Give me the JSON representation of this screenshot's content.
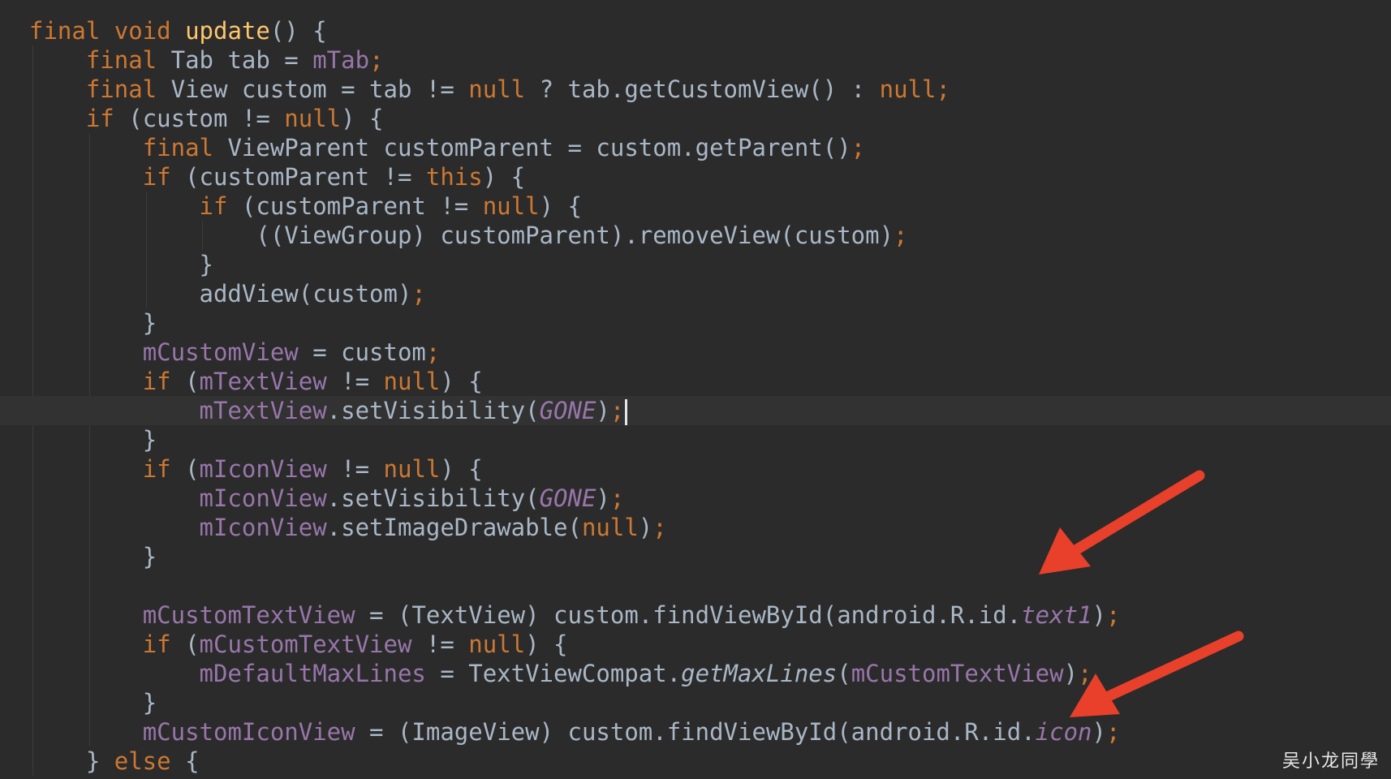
{
  "editor": {
    "lines": [
      [
        {
          "t": "final void ",
          "c": "kw"
        },
        {
          "t": "update",
          "c": "fn"
        },
        {
          "t": "() {",
          "c": "plain"
        }
      ],
      [
        {
          "t": "    "
        },
        {
          "t": "final ",
          "c": "kw"
        },
        {
          "t": "Tab tab = ",
          "c": "plain"
        },
        {
          "t": "mTab",
          "c": "fld"
        },
        {
          "t": ";",
          "c": "kw"
        }
      ],
      [
        {
          "t": "    "
        },
        {
          "t": "final ",
          "c": "kw"
        },
        {
          "t": "View custom = tab != ",
          "c": "plain"
        },
        {
          "t": "null ",
          "c": "kw"
        },
        {
          "t": "? tab.getCustomView() : ",
          "c": "plain"
        },
        {
          "t": "null;",
          "c": "kw"
        }
      ],
      [
        {
          "t": "    "
        },
        {
          "t": "if ",
          "c": "kw"
        },
        {
          "t": "(custom != ",
          "c": "plain"
        },
        {
          "t": "null",
          "c": "kw"
        },
        {
          "t": ") {",
          "c": "plain"
        }
      ],
      [
        {
          "t": "        "
        },
        {
          "t": "final ",
          "c": "kw"
        },
        {
          "t": "ViewParent customParent = custom.getParent()",
          "c": "plain"
        },
        {
          "t": ";",
          "c": "kw"
        }
      ],
      [
        {
          "t": "        "
        },
        {
          "t": "if ",
          "c": "kw"
        },
        {
          "t": "(customParent != ",
          "c": "plain"
        },
        {
          "t": "this",
          "c": "kw"
        },
        {
          "t": ") {",
          "c": "plain"
        }
      ],
      [
        {
          "t": "            "
        },
        {
          "t": "if ",
          "c": "kw"
        },
        {
          "t": "(customParent != ",
          "c": "plain"
        },
        {
          "t": "null",
          "c": "kw"
        },
        {
          "t": ") {",
          "c": "plain"
        }
      ],
      [
        {
          "t": "                "
        },
        {
          "t": "((ViewGroup) customParent).removeView(custom)",
          "c": "plain"
        },
        {
          "t": ";",
          "c": "kw"
        }
      ],
      [
        {
          "t": "            "
        },
        {
          "t": "}",
          "c": "plain"
        }
      ],
      [
        {
          "t": "            "
        },
        {
          "t": "addView(custom)",
          "c": "plain"
        },
        {
          "t": ";",
          "c": "kw"
        }
      ],
      [
        {
          "t": "        "
        },
        {
          "t": "}",
          "c": "plain"
        }
      ],
      [
        {
          "t": "        "
        },
        {
          "t": "mCustomView",
          "c": "fld"
        },
        {
          "t": " = custom",
          "c": "plain"
        },
        {
          "t": ";",
          "c": "kw"
        }
      ],
      [
        {
          "t": "        "
        },
        {
          "t": "if ",
          "c": "kw"
        },
        {
          "t": "(",
          "c": "plain"
        },
        {
          "t": "mTextView",
          "c": "fld"
        },
        {
          "t": " != ",
          "c": "plain"
        },
        {
          "t": "null",
          "c": "kw"
        },
        {
          "t": ") {",
          "c": "plain"
        }
      ],
      [
        {
          "t": "            "
        },
        {
          "t": "mTextView",
          "c": "fld"
        },
        {
          "t": ".setVisibility(",
          "c": "plain"
        },
        {
          "t": "GONE",
          "c": "fld ital"
        },
        {
          "t": ")",
          "c": "plain"
        },
        {
          "t": ";",
          "c": "kw"
        }
      ],
      [
        {
          "t": "        "
        },
        {
          "t": "}",
          "c": "plain"
        }
      ],
      [
        {
          "t": "        "
        },
        {
          "t": "if ",
          "c": "kw"
        },
        {
          "t": "(",
          "c": "plain"
        },
        {
          "t": "mIconView",
          "c": "fld"
        },
        {
          "t": " != ",
          "c": "plain"
        },
        {
          "t": "null",
          "c": "kw"
        },
        {
          "t": ") {",
          "c": "plain"
        }
      ],
      [
        {
          "t": "            "
        },
        {
          "t": "mIconView",
          "c": "fld"
        },
        {
          "t": ".setVisibility(",
          "c": "plain"
        },
        {
          "t": "GONE",
          "c": "fld ital"
        },
        {
          "t": ")",
          "c": "plain"
        },
        {
          "t": ";",
          "c": "kw"
        }
      ],
      [
        {
          "t": "            "
        },
        {
          "t": "mIconView",
          "c": "fld"
        },
        {
          "t": ".setImageDrawable(",
          "c": "plain"
        },
        {
          "t": "null",
          "c": "kw"
        },
        {
          "t": ")",
          "c": "plain"
        },
        {
          "t": ";",
          "c": "kw"
        }
      ],
      [
        {
          "t": "        "
        },
        {
          "t": "}",
          "c": "plain"
        }
      ],
      [
        {
          "t": ""
        }
      ],
      [
        {
          "t": "        "
        },
        {
          "t": "mCustomTextView",
          "c": "fld"
        },
        {
          "t": " = (TextView) custom.findViewById(android.R.id.",
          "c": "plain"
        },
        {
          "t": "text1",
          "c": "fld ital"
        },
        {
          "t": ")",
          "c": "plain"
        },
        {
          "t": ";",
          "c": "kw"
        }
      ],
      [
        {
          "t": "        "
        },
        {
          "t": "if ",
          "c": "kw"
        },
        {
          "t": "(",
          "c": "plain"
        },
        {
          "t": "mCustomTextView",
          "c": "fld"
        },
        {
          "t": " != ",
          "c": "plain"
        },
        {
          "t": "null",
          "c": "kw"
        },
        {
          "t": ") {",
          "c": "plain"
        }
      ],
      [
        {
          "t": "            "
        },
        {
          "t": "mDefaultMaxLines",
          "c": "fld"
        },
        {
          "t": " = TextViewCompat.",
          "c": "plain"
        },
        {
          "t": "getMaxLines",
          "c": "plain ital"
        },
        {
          "t": "(",
          "c": "plain"
        },
        {
          "t": "mCustomTextView",
          "c": "fld"
        },
        {
          "t": ")",
          "c": "plain"
        },
        {
          "t": ";",
          "c": "kw"
        }
      ],
      [
        {
          "t": "        "
        },
        {
          "t": "}",
          "c": "plain"
        }
      ],
      [
        {
          "t": "        "
        },
        {
          "t": "mCustomIconView",
          "c": "fld"
        },
        {
          "t": " = (ImageView) custom.findViewById(android.R.id.",
          "c": "plain"
        },
        {
          "t": "icon",
          "c": "fld ital"
        },
        {
          "t": ")",
          "c": "plain"
        },
        {
          "t": ";",
          "c": "kw"
        }
      ],
      [
        {
          "t": "    "
        },
        {
          "t": "} ",
          "c": "plain"
        },
        {
          "t": "else ",
          "c": "kw"
        },
        {
          "t": "{",
          "c": "plain"
        }
      ]
    ],
    "current_line_index": 13
  },
  "colors": {
    "background": "#2b2b2b",
    "keyword": "#cc7832",
    "method": "#ffc66d",
    "field": "#9876aa",
    "text": "#a9b7c6",
    "arrow": "#e8402a"
  },
  "icons": [
    "red-arrow-icon-upper",
    "red-arrow-icon-lower"
  ],
  "watermark": "吴小龙同學"
}
